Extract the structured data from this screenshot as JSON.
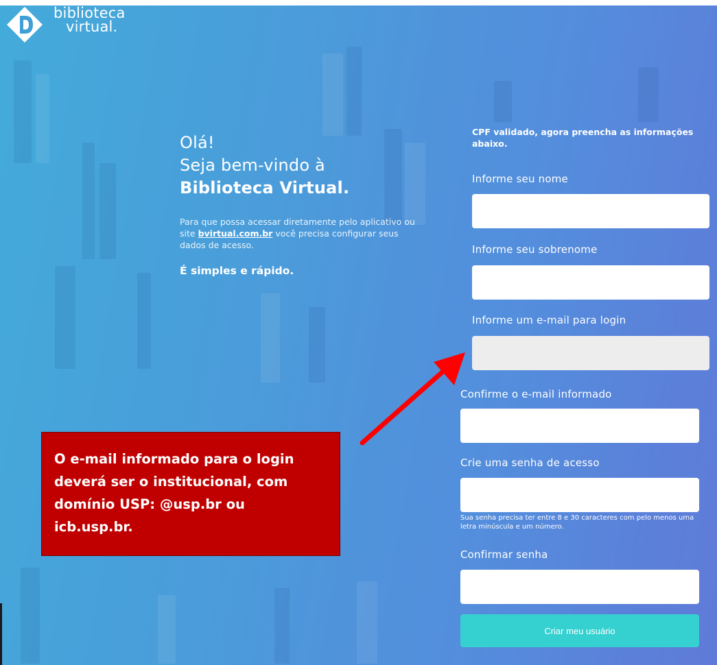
{
  "brand": {
    "name_line1": "biblioteca",
    "name_line2": "virtual.",
    "logo_icon": "diamond-b-icon",
    "color": "#ffffff"
  },
  "welcome": {
    "line1": "Olá!",
    "line2": "Seja bem-vindo à",
    "line3": "Biblioteca Virtual.",
    "desc_part1": "Para que possa acessar diretamente pelo aplicativo ou site",
    "desc_link": "bvirtual.com.br",
    "desc_part2": "você precisa configurar seus dados de acesso.",
    "simple": "É simples e rápido."
  },
  "form": {
    "status": "CPF validado, agora preencha as informações abaixo.",
    "nome_label": "Informe seu nome",
    "nome_value": "",
    "sobrenome_label": "Informe seu sobrenome",
    "sobrenome_value": "",
    "email_label": "Informe um e-mail para login",
    "email_value": "",
    "confirm_email_label": "Confirme o e-mail informado",
    "confirm_email_value": "",
    "senha_label": "Crie uma senha de acesso",
    "senha_value": "",
    "senha_hint": "Sua senha precisa ter entre 8 e 30 caracteres com pelo menos uma letra minúscula e um número.",
    "confirm_senha_label": "Confirmar senha",
    "confirm_senha_value": "",
    "submit_label": "Criar meu usuário",
    "submit_color": "#35d0d0"
  },
  "annotation": {
    "text": "O e-mail informado para o login deverá ser o institucional, com domínio USP: @usp.br ou icb.usp.br.",
    "box_color": "#c00000",
    "arrow_color": "#ff0000"
  }
}
